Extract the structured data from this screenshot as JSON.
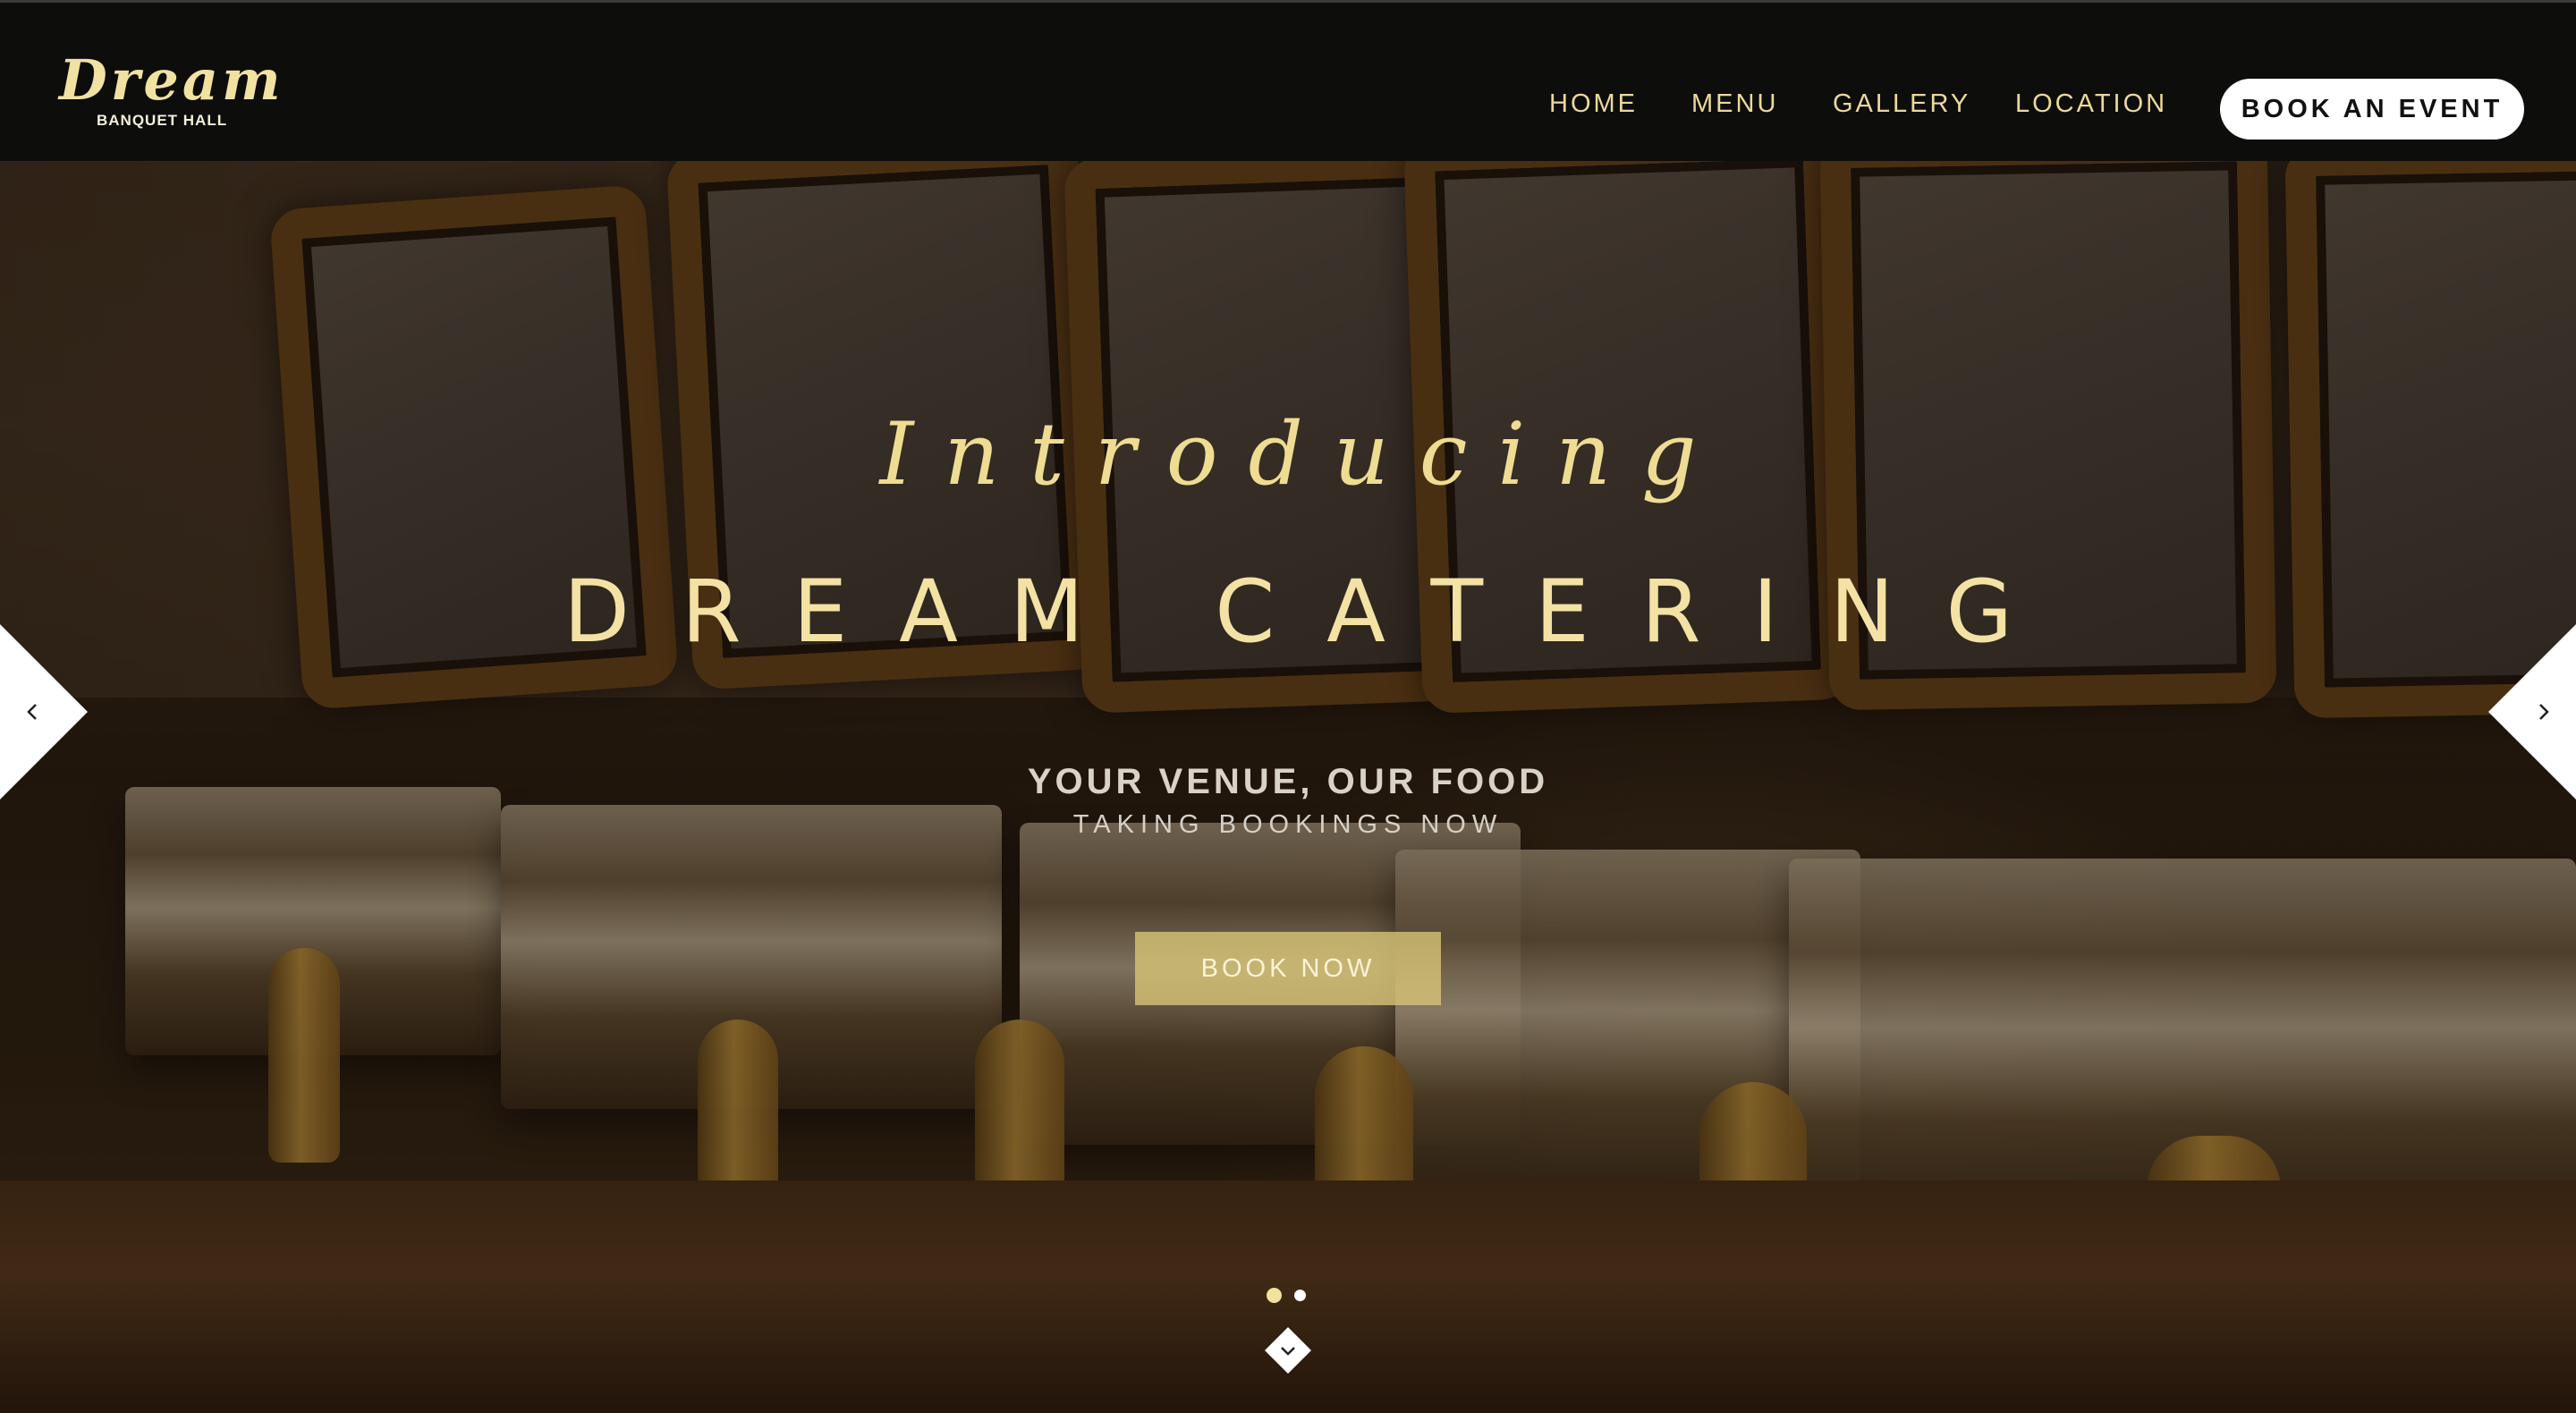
{
  "brand": {
    "logo_script": "Dream",
    "logo_sub": "BANQUET HALL"
  },
  "nav": {
    "items": [
      {
        "label": "HOME"
      },
      {
        "label": "MENU"
      },
      {
        "label": "GALLERY"
      },
      {
        "label": "LOCATION"
      }
    ],
    "cta_label": "BOOK AN EVENT"
  },
  "hero": {
    "intro": "Introducing",
    "title": "DREAM CATERING",
    "tagline": "YOUR VENUE, OUR FOOD",
    "subtag": "TAKING BOOKINGS NOW",
    "button_label": "BOOK NOW"
  },
  "carousel": {
    "prev_icon": "chevron-left-icon",
    "next_icon": "chevron-right-icon",
    "slides_total": 2,
    "active_slide": 1,
    "scroll_icon": "chevron-down-icon"
  },
  "colors": {
    "accent_gold": "#efdc93",
    "header_bg": "#0d0d0c",
    "cta_bg": "#ffffff",
    "button_gold": "#dac678"
  }
}
